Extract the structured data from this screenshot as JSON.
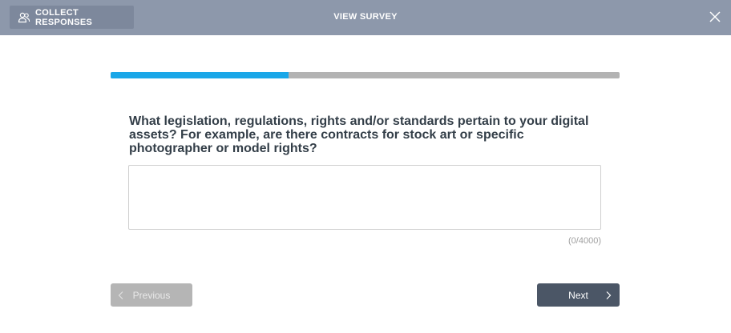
{
  "topbar": {
    "collect_label": "COLLECT RESPONSES",
    "collect_icon": "users-icon",
    "title": "VIEW SURVEY",
    "close_icon": "close-icon",
    "background_color": "#8d98ab"
  },
  "progress": {
    "fraction": 0.35,
    "fill_color": "#1aa7e8",
    "track_color": "#b3b3b3"
  },
  "question": {
    "text": "What legislation, regulations, rights and/or standards pertain to your digital assets? For example, are there contracts for stock art or specific photographer or model rights?",
    "answer_value": "",
    "char_count": "(0/4000)"
  },
  "nav": {
    "previous_label": "Previous",
    "previous_icon": "chevron-left-icon",
    "next_label": "Next",
    "next_icon": "chevron-right-icon"
  }
}
